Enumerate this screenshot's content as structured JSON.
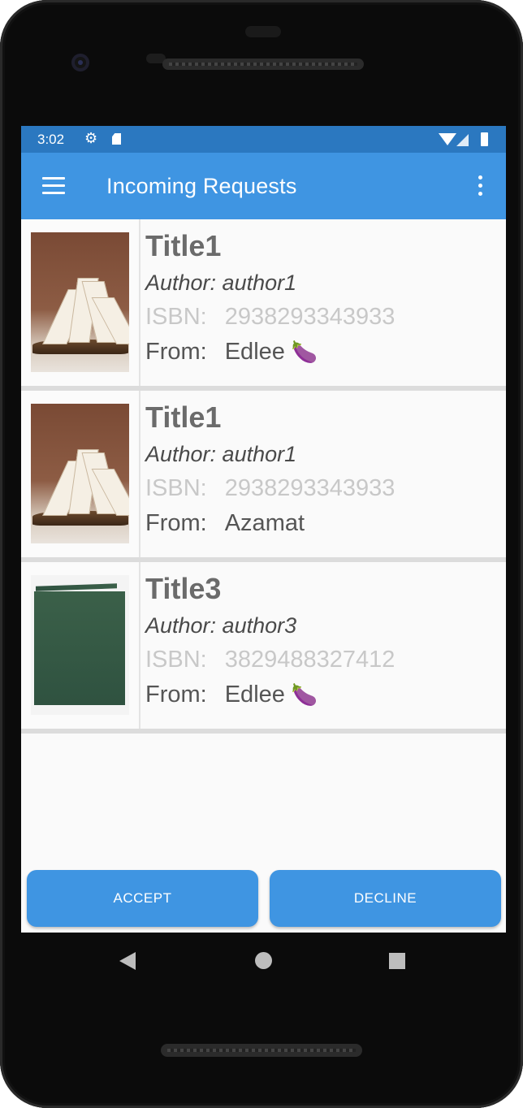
{
  "status_bar": {
    "time": "3:02",
    "icons": [
      "gear-icon",
      "sd-card-icon",
      "wifi-icon",
      "signal-icon",
      "battery-icon"
    ]
  },
  "app_bar": {
    "title": "Incoming Requests",
    "menu_icon": "hamburger-menu-icon",
    "overflow_icon": "more-vert-icon",
    "color": "#3f95e2"
  },
  "requests": [
    {
      "title": "Title1",
      "author": "Author: author1",
      "isbn_label": "ISBN:",
      "isbn": "2938293343933",
      "from_label": "From:",
      "from": "Edlee",
      "emoji": "🍆",
      "thumbnail": "open-book-image"
    },
    {
      "title": "Title1",
      "author": "Author: author1",
      "isbn_label": "ISBN:",
      "isbn": "2938293343933",
      "from_label": "From:",
      "from": "Azamat",
      "emoji": "",
      "thumbnail": "open-book-image"
    },
    {
      "title": "Title3",
      "author": "Author: author3",
      "isbn_label": "ISBN:",
      "isbn": "3829488327412",
      "from_label": "From:",
      "from": "Edlee",
      "emoji": "🍆",
      "thumbnail": "green-book-image"
    }
  ],
  "actions": {
    "accept_label": "ACCEPT",
    "decline_label": "DECLINE"
  },
  "nav_bar": {
    "icons": [
      "back-icon",
      "home-icon",
      "recents-icon"
    ]
  }
}
